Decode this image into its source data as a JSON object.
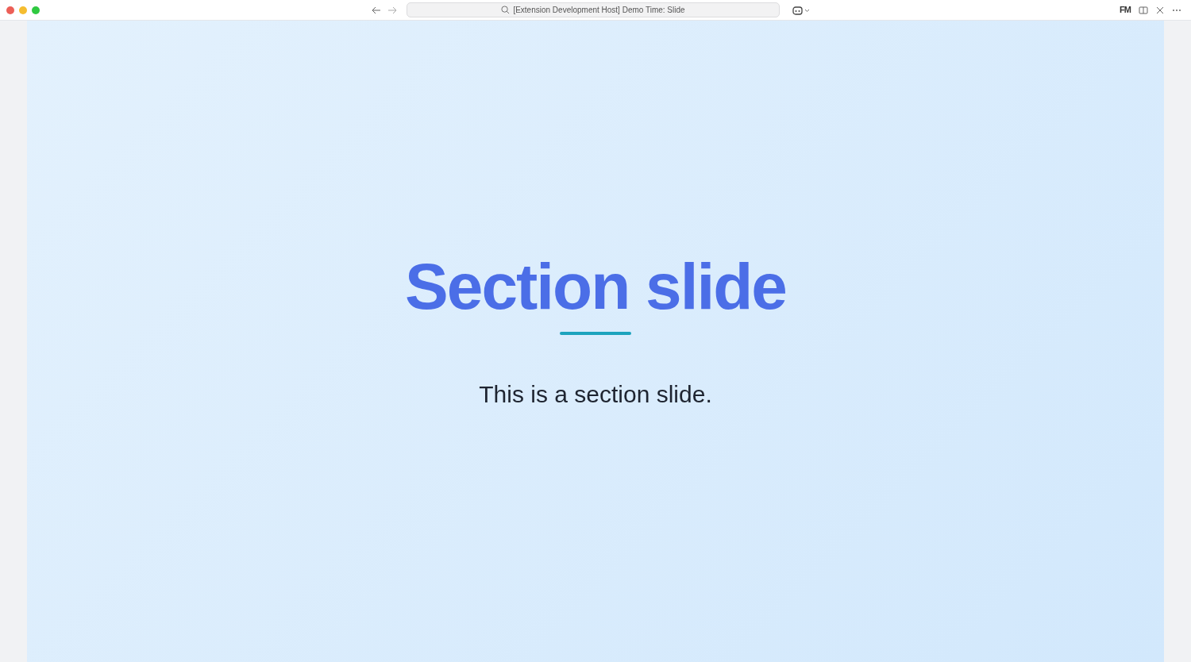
{
  "window": {
    "title": "[Extension Development Host] Demo Time: Slide"
  },
  "toolbar": {
    "badge": "FM"
  },
  "slide": {
    "title": "Section slide",
    "subtitle": "This is a section slide."
  }
}
